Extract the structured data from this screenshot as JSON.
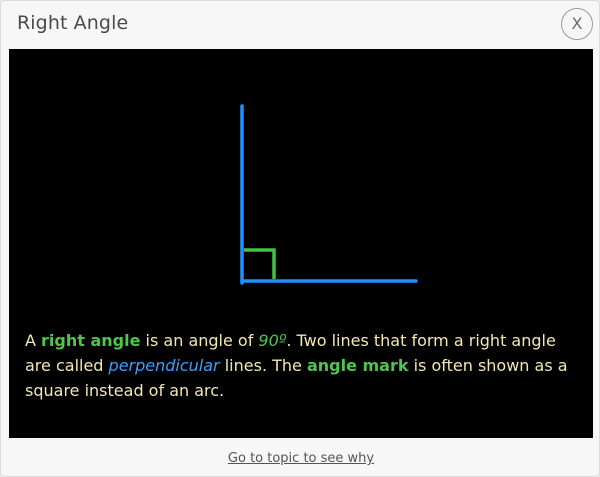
{
  "dialog": {
    "title": "Right Angle",
    "close_label": "X"
  },
  "figure": {
    "line_color": "#1e90ff",
    "angle_mark_color": "#3fc43f",
    "angle_degrees": 90
  },
  "caption": {
    "p1": "A ",
    "term1": "right angle",
    "p2": " is an angle of ",
    "degrees": "90º",
    "p3": ". Two lines that form a right angle are called ",
    "term2": "perpendicular",
    "p4": " lines. The ",
    "term3": "angle mark",
    "p5": " is often shown as a square instead of an arc."
  },
  "footer": {
    "link_label": "Go to topic to see why"
  }
}
